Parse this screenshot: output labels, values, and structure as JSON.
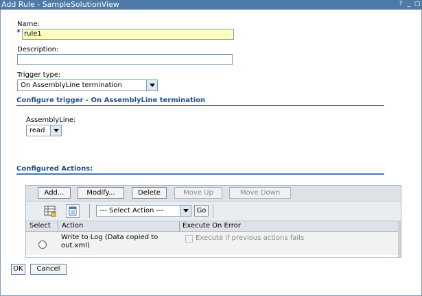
{
  "window": {
    "title": "Add Rule - SampleSolutionView",
    "controls": {
      "help": "?",
      "minimize": "_",
      "maximize": "□"
    }
  },
  "form": {
    "required_marker": "*",
    "name_label": "Name:",
    "name_value": "rule1",
    "description_label": "Description:",
    "description_value": "",
    "trigger_type_label": "Trigger type:",
    "trigger_type_value": "On AssemblyLine termination"
  },
  "configure_trigger": {
    "heading": "Configure trigger - On AssemblyLine termination",
    "assemblyline_label": "AssemblyLine:",
    "assemblyline_value": "read"
  },
  "configured_actions": {
    "heading": "Configured Actions:",
    "buttons": {
      "add": "Add...",
      "modify": "Modify...",
      "delete": "Delete",
      "move_up": "Move Up",
      "move_down": "Move Down"
    },
    "select_action": "--- Select Action ---",
    "go": "Go",
    "columns": [
      "Select",
      "Action",
      "Execute On Error"
    ],
    "rows": [
      {
        "action": "Write to Log (Data copied to out.xml)",
        "execute_on_error": "Execute if previous actions fails"
      }
    ]
  },
  "footer": {
    "ok": "OK",
    "cancel": "Cancel"
  },
  "colors": {
    "titlebar": "#4f7aa8",
    "section_heading": "#1f4e8c",
    "name_input_bg": "#ffffc0"
  }
}
